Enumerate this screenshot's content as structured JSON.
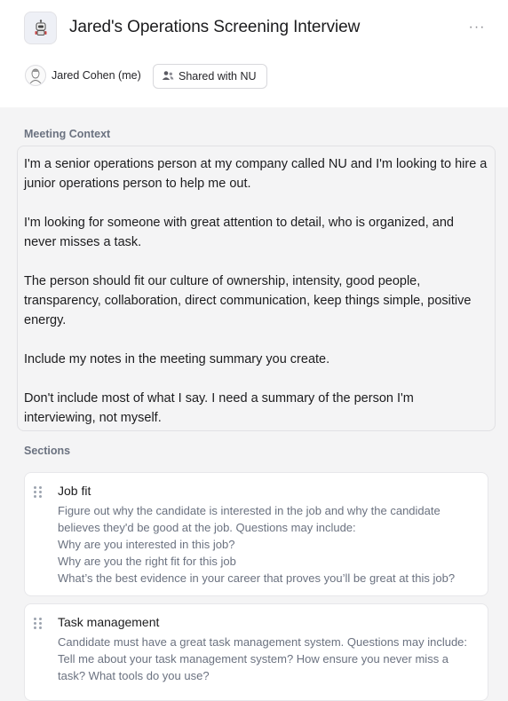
{
  "header": {
    "title": "Jared's Operations Screening Interview",
    "owner_name": "Jared Cohen (me)",
    "share_label": "Shared with NU",
    "more_label": "···"
  },
  "context": {
    "label": "Meeting Context",
    "paragraphs": [
      "I'm a senior operations person at my company called NU and I'm looking to hire a junior operations person to help me out.",
      "I'm looking for someone with great attention to detail, who is organized, and never misses a task.",
      "The person should fit our culture of ownership, intensity, good people, transparency, collaboration, direct communication, keep things simple, positive energy.",
      "Include my notes in the meeting summary you create.",
      "Don't include most of what I say. I need a summary of the person I'm interviewing, not myself."
    ]
  },
  "sections": {
    "label": "Sections",
    "items": [
      {
        "title": "Job fit",
        "lines": [
          "Figure out why the candidate is interested in the job and why the candidate believes they'd be good at the job. Questions may include:",
          "Why are you interested in this job?",
          "Why are you the right fit for this job",
          "What’s the best evidence in your career that proves you’ll be great at this job?"
        ]
      },
      {
        "title": "Task management",
        "lines": [
          "Candidate must have a great task management system. Questions may include:",
          "Tell me about your task management system? How ensure you never miss a task? What tools do you use?"
        ]
      }
    ]
  },
  "colors": {
    "background": "#f4f4f5",
    "muted_text": "#6b7280",
    "card": "#ffffff"
  },
  "icons": {
    "app": "robot-icon",
    "more": "more-horizontal-icon",
    "share": "users-icon",
    "drag": "drag-handle-icon"
  }
}
